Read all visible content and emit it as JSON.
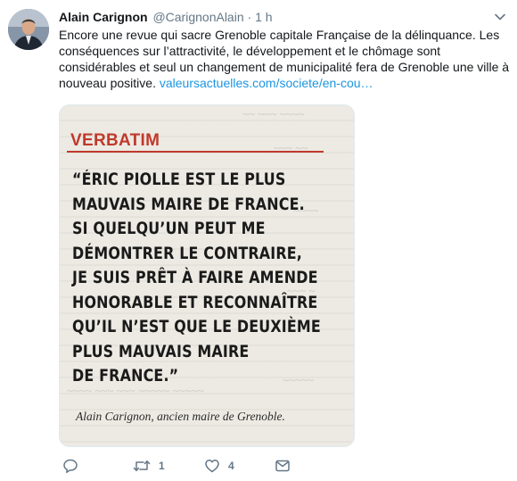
{
  "tweet": {
    "display_name": "Alain Carignon",
    "handle": "@CarignonAlain",
    "separator": "·",
    "time": "1 h",
    "text": "Encore une revue qui sacre Grenoble capitale Française de la délinquance. Les conséquences sur l’attractivité, le développement et le chômage sont considérables et seul un changement de municipalité fera de Grenoble une ville à nouveau positive. ",
    "link": "valeursactuelles.com/societe/en-cou…"
  },
  "media": {
    "section_label": "VERBATIM",
    "quote_lines": [
      "“ÉRIC PIOLLE EST LE PLUS",
      "MAUVAIS MAIRE DE FRANCE.",
      "SI QUELQU’UN PEUT ME",
      "DÉMONTRER LE CONTRAIRE,",
      "JE SUIS PRÊT À FAIRE AMENDE",
      "HONORABLE ET RECONNAÎTRE",
      "QU’IL N’EST QUE LE DEUXIÈME",
      "PLUS MAUVAIS MAIRE",
      "DE FRANCE.”"
    ],
    "attribution": "Alain Carignon, ancien maire de Grenoble."
  },
  "actions": {
    "retweet_count": "1",
    "like_count": "4"
  },
  "colors": {
    "link": "#1b95e0",
    "secondary_text": "#657786",
    "verbatim_red": "#c0392b"
  },
  "icons": [
    "chevron-down-icon",
    "reply-icon",
    "retweet-icon",
    "like-icon",
    "direct-message-icon"
  ]
}
